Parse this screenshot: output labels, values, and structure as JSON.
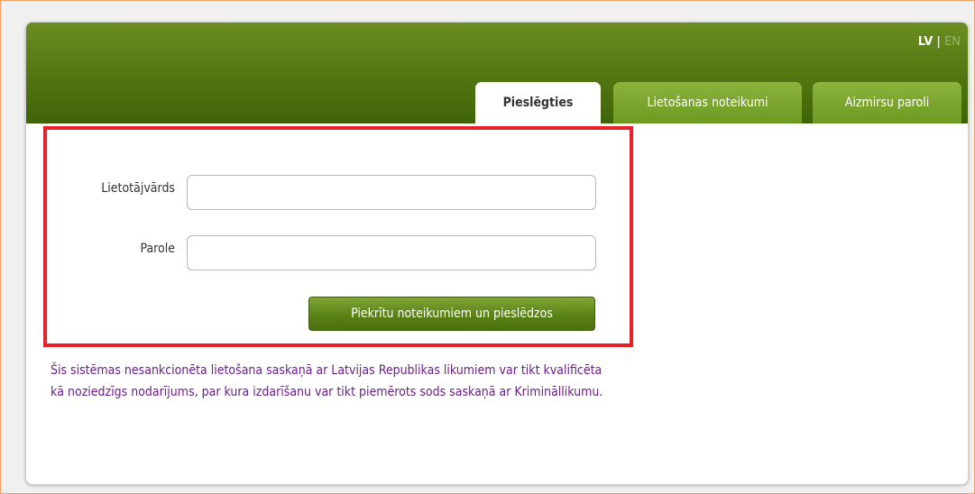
{
  "language": {
    "active": "LV",
    "separator": "|",
    "inactive": "EN"
  },
  "tabs": [
    {
      "label": "Pieslēgties",
      "active": true
    },
    {
      "label": "Lietošanas noteikumi",
      "active": false
    },
    {
      "label": "Aizmirsu paroli",
      "active": false
    }
  ],
  "form": {
    "username_label": "Lietotājvārds",
    "username_value": "",
    "password_label": "Parole",
    "password_value": "",
    "submit_label": "Piekrītu noteikumiem un pieslēdzos"
  },
  "notice": "Šis sistēmas nesankcionēta lietošana saskaņā ar Latvijas Republikas likumiem var tikt kvalificēta kā noziedzīgs nodarījums, par kura izdarīšanu var tikt piemērots sods saskaņā ar Krimināllikumu.",
  "colors": {
    "header_green": "#557a12",
    "tab_green": "#7aa52e",
    "highlight_red": "#e8202a",
    "notice_purple": "#6a1f8a"
  }
}
